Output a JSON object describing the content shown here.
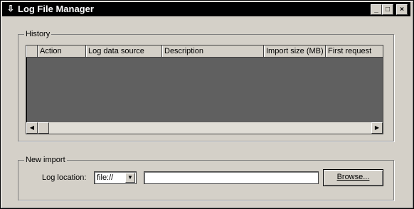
{
  "window": {
    "title": "Log File Manager",
    "icon": "download-arrow-icon",
    "controls": {
      "minimize": "_",
      "maximize": "□",
      "close": "×"
    }
  },
  "history": {
    "label": "History",
    "columns": [
      "",
      "Action",
      "Log data source",
      "Description",
      "Import size (MB)",
      "First request"
    ],
    "rows": [],
    "scroll_left": "◀",
    "scroll_right": "▶"
  },
  "new_import": {
    "label": "New import",
    "log_location_label": "Log location:",
    "protocol_value": "file://",
    "protocol_arrow": "▼",
    "path_value": "",
    "browse_label": "Browse..."
  }
}
